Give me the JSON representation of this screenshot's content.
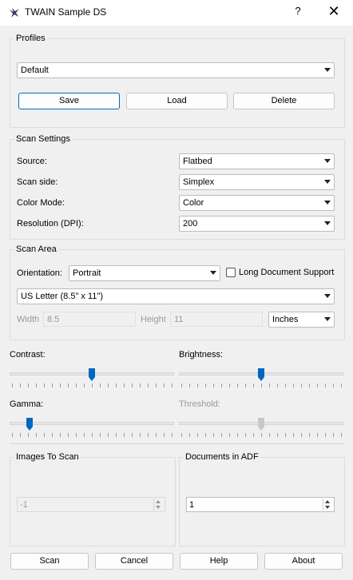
{
  "window": {
    "title": "TWAIN Sample DS",
    "help_glyph": "?",
    "close_glyph": "✕"
  },
  "profiles": {
    "group_label": "Profiles",
    "selected": "Default",
    "save_label": "Save",
    "load_label": "Load",
    "delete_label": "Delete"
  },
  "scan_settings": {
    "group_label": "Scan Settings",
    "source_label": "Source:",
    "source_value": "Flatbed",
    "side_label": "Scan side:",
    "side_value": "Simplex",
    "color_label": "Color Mode:",
    "color_value": "Color",
    "resolution_label": "Resolution (DPI):",
    "resolution_value": "200"
  },
  "scan_area": {
    "group_label": "Scan Area",
    "orientation_label": "Orientation:",
    "orientation_value": "Portrait",
    "long_doc_label": "Long Document Support",
    "long_doc_checked": false,
    "paper_size": "US Letter (8.5\" x 11\")",
    "width_label": "Width",
    "width_value": "8.5",
    "height_label": "Height",
    "height_value": "11",
    "units_value": "Inches"
  },
  "sliders": {
    "contrast": {
      "label": "Contrast:",
      "level": 0.5,
      "enabled": true
    },
    "brightness": {
      "label": "Brightness:",
      "level": 0.5,
      "enabled": true
    },
    "gamma": {
      "label": "Gamma:",
      "level": 0.1,
      "enabled": true
    },
    "threshold": {
      "label": "Threshold:",
      "level": 0.5,
      "enabled": false
    }
  },
  "images_to_scan": {
    "group_label": "Images To Scan",
    "value": "-1"
  },
  "documents_in_adf": {
    "group_label": "Documents in ADF",
    "value": "1"
  },
  "footer": {
    "scan_label": "Scan",
    "cancel_label": "Cancel",
    "help_label": "Help",
    "about_label": "About"
  },
  "colors": {
    "accent": "#0067c0",
    "disabled_thumb": "#c8c8c8"
  }
}
